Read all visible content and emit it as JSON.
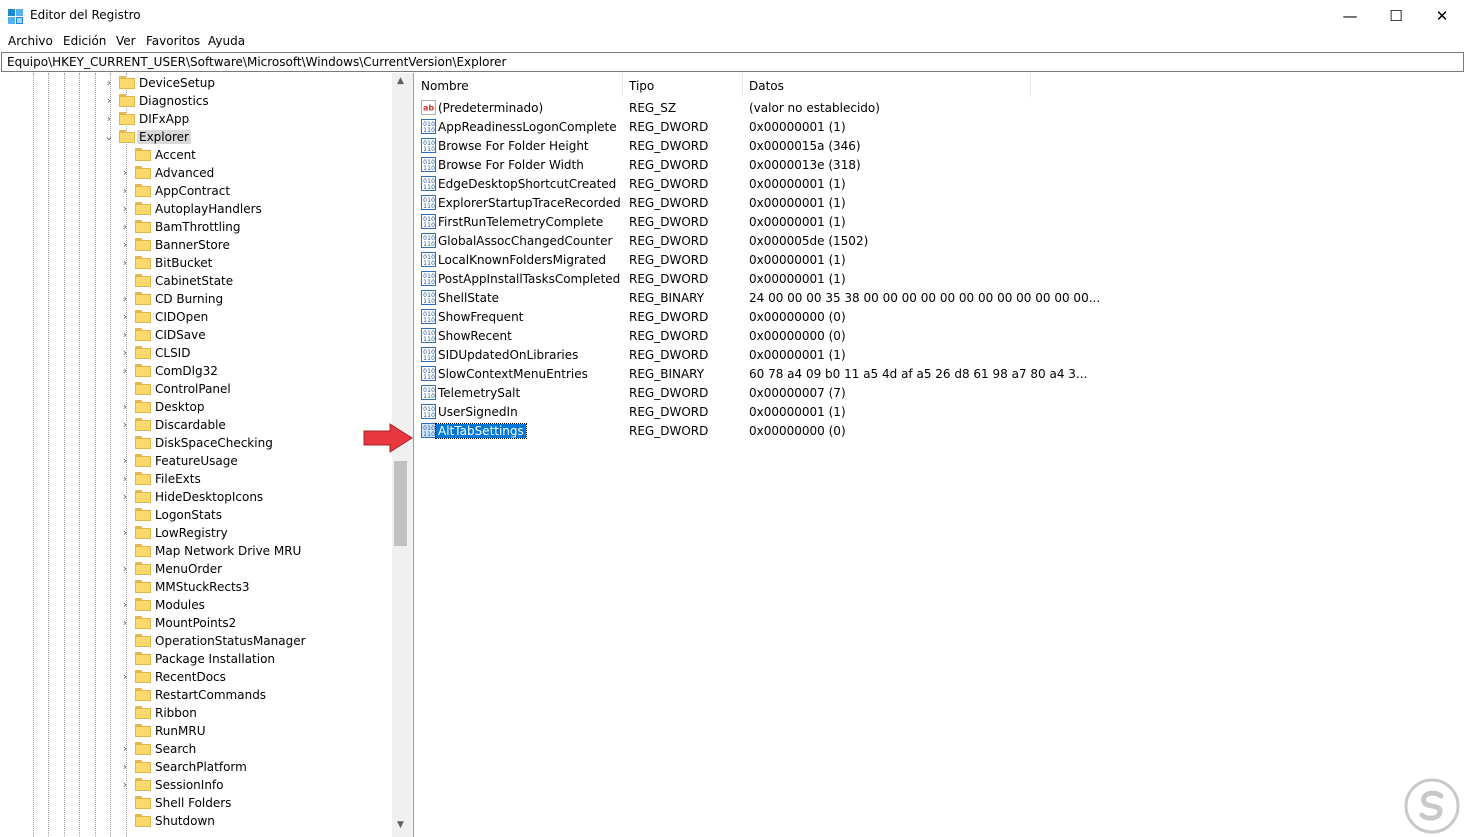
{
  "window": {
    "title": "Editor del Registro",
    "app_icon": "registry-editor-icon",
    "buttons": {
      "minimize": "—",
      "maximize": "☐",
      "close": "✕"
    }
  },
  "menu": [
    "Archivo",
    "Edición",
    "Ver",
    "Favoritos",
    "Ayuda"
  ],
  "address": "Equipo\\HKEY_CURRENT_USER\\Software\\Microsoft\\Windows\\CurrentVersion\\Explorer",
  "tree": {
    "items": [
      {
        "label": "DeviceSetup",
        "level": 0,
        "expander": "collapsed"
      },
      {
        "label": "Diagnostics",
        "level": 0,
        "expander": "collapsed"
      },
      {
        "label": "DIFxApp",
        "level": 0,
        "expander": "collapsed"
      },
      {
        "label": "Explorer",
        "level": 0,
        "expander": "expanded",
        "selected": true
      },
      {
        "label": "Accent",
        "level": 1,
        "expander": "none"
      },
      {
        "label": "Advanced",
        "level": 1,
        "expander": "collapsed"
      },
      {
        "label": "AppContract",
        "level": 1,
        "expander": "collapsed"
      },
      {
        "label": "AutoplayHandlers",
        "level": 1,
        "expander": "collapsed"
      },
      {
        "label": "BamThrottling",
        "level": 1,
        "expander": "collapsed"
      },
      {
        "label": "BannerStore",
        "level": 1,
        "expander": "collapsed"
      },
      {
        "label": "BitBucket",
        "level": 1,
        "expander": "collapsed"
      },
      {
        "label": "CabinetState",
        "level": 1,
        "expander": "none"
      },
      {
        "label": "CD Burning",
        "level": 1,
        "expander": "collapsed"
      },
      {
        "label": "CIDOpen",
        "level": 1,
        "expander": "collapsed"
      },
      {
        "label": "CIDSave",
        "level": 1,
        "expander": "collapsed"
      },
      {
        "label": "CLSID",
        "level": 1,
        "expander": "collapsed"
      },
      {
        "label": "ComDlg32",
        "level": 1,
        "expander": "collapsed"
      },
      {
        "label": "ControlPanel",
        "level": 1,
        "expander": "none"
      },
      {
        "label": "Desktop",
        "level": 1,
        "expander": "collapsed"
      },
      {
        "label": "Discardable",
        "level": 1,
        "expander": "collapsed"
      },
      {
        "label": "DiskSpaceChecking",
        "level": 1,
        "expander": "none"
      },
      {
        "label": "FeatureUsage",
        "level": 1,
        "expander": "collapsed"
      },
      {
        "label": "FileExts",
        "level": 1,
        "expander": "collapsed"
      },
      {
        "label": "HideDesktopIcons",
        "level": 1,
        "expander": "collapsed"
      },
      {
        "label": "LogonStats",
        "level": 1,
        "expander": "none"
      },
      {
        "label": "LowRegistry",
        "level": 1,
        "expander": "collapsed"
      },
      {
        "label": "Map Network Drive MRU",
        "level": 1,
        "expander": "none"
      },
      {
        "label": "MenuOrder",
        "level": 1,
        "expander": "collapsed"
      },
      {
        "label": "MMStuckRects3",
        "level": 1,
        "expander": "none"
      },
      {
        "label": "Modules",
        "level": 1,
        "expander": "collapsed"
      },
      {
        "label": "MountPoints2",
        "level": 1,
        "expander": "collapsed"
      },
      {
        "label": "OperationStatusManager",
        "level": 1,
        "expander": "none"
      },
      {
        "label": "Package Installation",
        "level": 1,
        "expander": "none"
      },
      {
        "label": "RecentDocs",
        "level": 1,
        "expander": "collapsed"
      },
      {
        "label": "RestartCommands",
        "level": 1,
        "expander": "none"
      },
      {
        "label": "Ribbon",
        "level": 1,
        "expander": "none"
      },
      {
        "label": "RunMRU",
        "level": 1,
        "expander": "none"
      },
      {
        "label": "Search",
        "level": 1,
        "expander": "collapsed"
      },
      {
        "label": "SearchPlatform",
        "level": 1,
        "expander": "collapsed"
      },
      {
        "label": "SessionInfo",
        "level": 1,
        "expander": "collapsed"
      },
      {
        "label": "Shell Folders",
        "level": 1,
        "expander": "none"
      },
      {
        "label": "Shutdown",
        "level": 1,
        "expander": "none"
      }
    ]
  },
  "list": {
    "columns": [
      "Nombre",
      "Tipo",
      "Datos"
    ],
    "rows": [
      {
        "name": "(Predeterminado)",
        "type": "REG_SZ",
        "data": "(valor no establecido)",
        "icon": "string-value-icon"
      },
      {
        "name": "AppReadinessLogonComplete",
        "type": "REG_DWORD",
        "data": "0x00000001 (1)",
        "icon": "binary-value-icon"
      },
      {
        "name": "Browse For Folder Height",
        "type": "REG_DWORD",
        "data": "0x0000015a (346)",
        "icon": "binary-value-icon"
      },
      {
        "name": "Browse For Folder Width",
        "type": "REG_DWORD",
        "data": "0x0000013e (318)",
        "icon": "binary-value-icon"
      },
      {
        "name": "EdgeDesktopShortcutCreated",
        "type": "REG_DWORD",
        "data": "0x00000001 (1)",
        "icon": "binary-value-icon"
      },
      {
        "name": "ExplorerStartupTraceRecorded",
        "type": "REG_DWORD",
        "data": "0x00000001 (1)",
        "icon": "binary-value-icon"
      },
      {
        "name": "FirstRunTelemetryComplete",
        "type": "REG_DWORD",
        "data": "0x00000001 (1)",
        "icon": "binary-value-icon"
      },
      {
        "name": "GlobalAssocChangedCounter",
        "type": "REG_DWORD",
        "data": "0x000005de (1502)",
        "icon": "binary-value-icon"
      },
      {
        "name": "LocalKnownFoldersMigrated",
        "type": "REG_DWORD",
        "data": "0x00000001 (1)",
        "icon": "binary-value-icon"
      },
      {
        "name": "PostAppInstallTasksCompleted",
        "type": "REG_DWORD",
        "data": "0x00000001 (1)",
        "icon": "binary-value-icon"
      },
      {
        "name": "ShellState",
        "type": "REG_BINARY",
        "data": "24 00 00 00 35 38 00 00 00 00 00 00 00 00 00 00 00 00...",
        "icon": "binary-value-icon"
      },
      {
        "name": "ShowFrequent",
        "type": "REG_DWORD",
        "data": "0x00000000 (0)",
        "icon": "binary-value-icon"
      },
      {
        "name": "ShowRecent",
        "type": "REG_DWORD",
        "data": "0x00000000 (0)",
        "icon": "binary-value-icon"
      },
      {
        "name": "SIDUpdatedOnLibraries",
        "type": "REG_DWORD",
        "data": "0x00000001 (1)",
        "icon": "binary-value-icon"
      },
      {
        "name": "SlowContextMenuEntries",
        "type": "REG_BINARY",
        "data": "60 78 a4 09 b0 11 a5 4d af a5 26 d8 61 98 a7 80 a4 3...",
        "icon": "binary-value-icon"
      },
      {
        "name": "TelemetrySalt",
        "type": "REG_DWORD",
        "data": "0x00000007 (7)",
        "icon": "binary-value-icon"
      },
      {
        "name": "UserSignedIn",
        "type": "REG_DWORD",
        "data": "0x00000001 (1)",
        "icon": "binary-value-icon"
      },
      {
        "name": "AltTabSettings",
        "type": "REG_DWORD",
        "data": "0x00000000 (0)",
        "icon": "binary-value-icon",
        "selected": true
      }
    ]
  },
  "colors": {
    "selection": "#0078d7",
    "arrow": "#e8373e",
    "folder": "#fcd96b"
  },
  "annotation": {
    "arrow_icon": "red-arrow-icon"
  },
  "watermark": {
    "icon": "solvetic-logo-icon"
  }
}
